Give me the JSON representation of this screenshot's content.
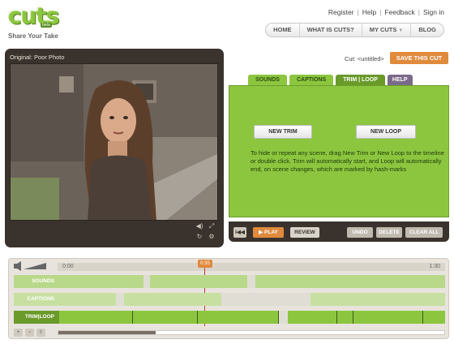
{
  "brand": {
    "logo_text": "cuts",
    "logo_sub": "beta",
    "tagline": "Share Your Take"
  },
  "top_links": [
    "Register",
    "Help",
    "Feedback",
    "Sign in"
  ],
  "nav": {
    "home": "HOME",
    "what": "WHAT IS CUTS?",
    "my_cuts": "MY CUTS",
    "blog": "BLOG"
  },
  "video": {
    "title": "Original: Poor Photo"
  },
  "cut": {
    "label": "Cut: <untitled>",
    "save_label": "SAVE THIS CUT"
  },
  "tabs": {
    "sounds": "SOUNDS",
    "captions": "CAPTIONS",
    "trim_loop": "TRIM | LOOP",
    "help": "HELP",
    "active": "TRIM | LOOP"
  },
  "panel": {
    "new_trim": "NEW TRIM",
    "new_loop": "NEW LOOP",
    "instructions": "To hide or repeat any scene, drag New Trim or New Loop to the timeline or double click. Trim will automatically start, and Loop will automatically end, on scene changes, which are marked by hash-marks"
  },
  "playbar": {
    "skip": "I◀◀",
    "play": "▶ PLAY",
    "review": "REVIEW",
    "undo": "UNDO",
    "delete": "DELETE",
    "clear": "CLEAR ALL"
  },
  "timeline": {
    "start_time": "0:00",
    "end_time": "1:30",
    "playhead_time": "0:35",
    "tracks": {
      "sounds": "SOUNDS",
      "captions": "CAPTIONS",
      "trim_loop": "TRIM|LOOP"
    }
  },
  "colors": {
    "accent": "#e08a3c",
    "green": "#8cc63f",
    "dark": "#3a332d"
  }
}
